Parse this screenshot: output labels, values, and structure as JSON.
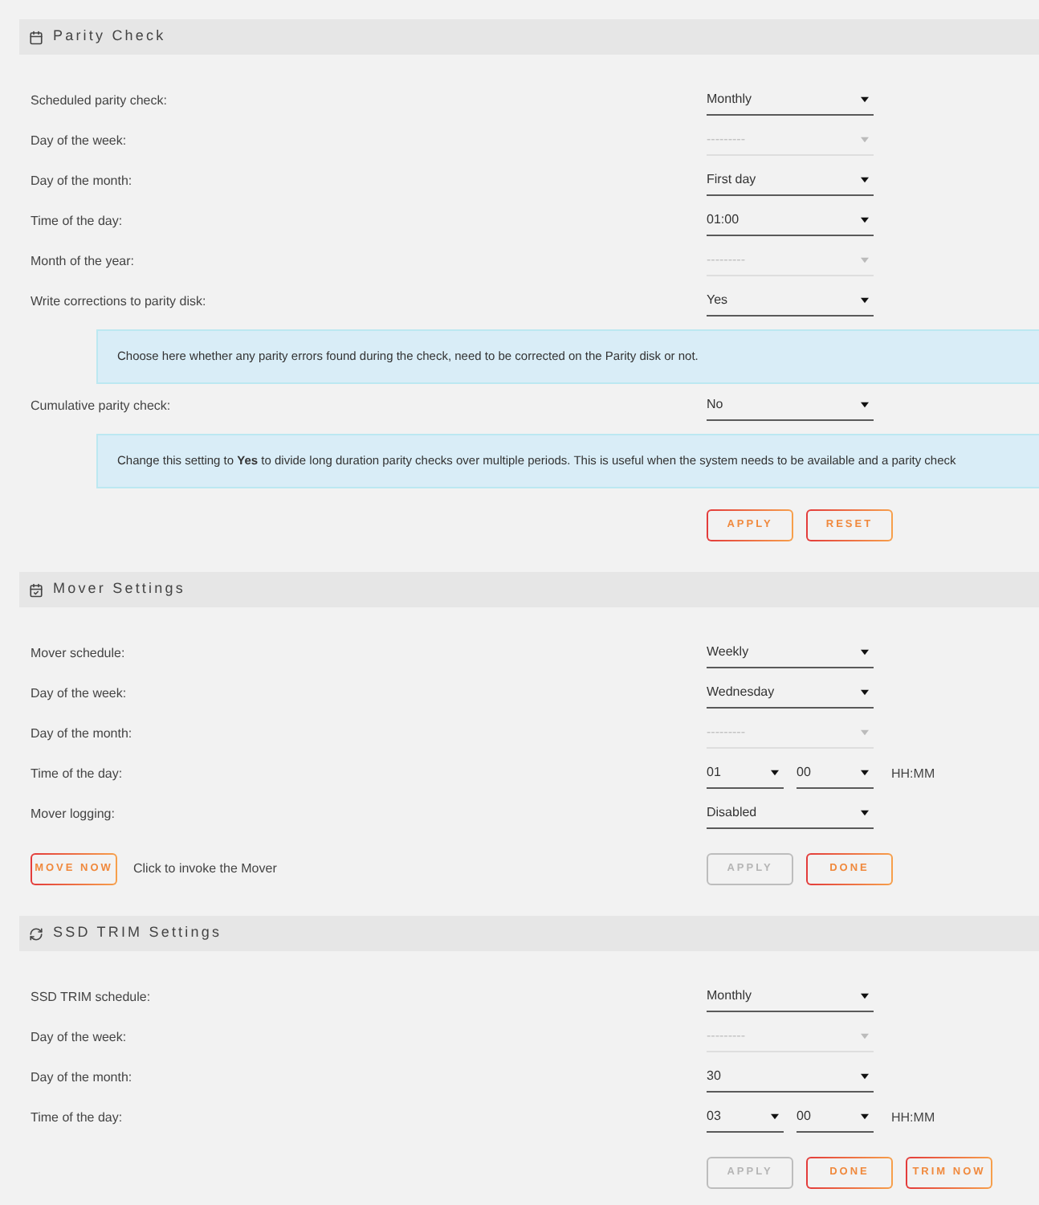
{
  "sections": [
    {
      "title": "Parity Check",
      "rows": [
        {
          "kind": "field",
          "label": "Scheduled parity check:",
          "selects": [
            {
              "value": "Monthly",
              "disabled": false
            }
          ]
        },
        {
          "kind": "field",
          "label": "Day of the week:",
          "selects": [
            {
              "value": "---------",
              "disabled": true
            }
          ]
        },
        {
          "kind": "field",
          "label": "Day of the month:",
          "selects": [
            {
              "value": "First day",
              "disabled": false
            }
          ]
        },
        {
          "kind": "field",
          "label": "Time of the day:",
          "selects": [
            {
              "value": "01:00",
              "disabled": false
            }
          ]
        },
        {
          "kind": "field",
          "label": "Month of the year:",
          "selects": [
            {
              "value": "---------",
              "disabled": true
            }
          ]
        },
        {
          "kind": "field",
          "label": "Write corrections to parity disk:",
          "selects": [
            {
              "value": "Yes",
              "disabled": false
            }
          ]
        },
        {
          "kind": "info",
          "text": "Choose here whether any parity errors found during the check, need to be corrected on the Parity disk or not."
        },
        {
          "kind": "field",
          "label": "Cumulative parity check:",
          "selects": [
            {
              "value": "No",
              "disabled": false
            }
          ]
        },
        {
          "kind": "info",
          "text": "Change this setting to **Yes** to divide long duration parity checks over multiple periods. This is useful when the system needs to be available and a parity check"
        }
      ],
      "actions": {
        "buttons": [
          {
            "label": "APPLY",
            "disabled": false
          },
          {
            "label": "RESET",
            "disabled": false
          }
        ]
      }
    },
    {
      "title": "Mover Settings",
      "rows": [
        {
          "kind": "field",
          "label": "Mover schedule:",
          "selects": [
            {
              "value": "Weekly",
              "disabled": false
            }
          ]
        },
        {
          "kind": "field",
          "label": "Day of the week:",
          "selects": [
            {
              "value": "Wednesday",
              "disabled": false
            }
          ]
        },
        {
          "kind": "field",
          "label": "Day of the month:",
          "selects": [
            {
              "value": "---------",
              "disabled": true
            }
          ]
        },
        {
          "kind": "field",
          "label": "Time of the day:",
          "selects": [
            {
              "value": "01",
              "disabled": false
            },
            {
              "value": "00",
              "disabled": false
            }
          ],
          "suffix": "HH:MM"
        },
        {
          "kind": "field",
          "label": "Mover logging:",
          "selects": [
            {
              "value": "Disabled",
              "disabled": false
            }
          ]
        }
      ],
      "actions": {
        "left_buttons": [
          {
            "label": "MOVE NOW",
            "disabled": false
          }
        ],
        "note": "Click to invoke the Mover",
        "buttons": [
          {
            "label": "APPLY",
            "disabled": true
          },
          {
            "label": "DONE",
            "disabled": false
          }
        ]
      }
    },
    {
      "title": "SSD TRIM Settings",
      "rows": [
        {
          "kind": "field",
          "label": "SSD TRIM schedule:",
          "selects": [
            {
              "value": "Monthly",
              "disabled": false
            }
          ]
        },
        {
          "kind": "field",
          "label": "Day of the week:",
          "selects": [
            {
              "value": "---------",
              "disabled": true
            }
          ]
        },
        {
          "kind": "field",
          "label": "Day of the month:",
          "selects": [
            {
              "value": "30",
              "disabled": false
            }
          ]
        },
        {
          "kind": "field",
          "label": "Time of the day:",
          "selects": [
            {
              "value": "03",
              "disabled": false
            },
            {
              "value": "00",
              "disabled": false
            }
          ],
          "suffix": "HH:MM"
        }
      ],
      "actions": {
        "buttons": [
          {
            "label": "APPLY",
            "disabled": true
          },
          {
            "label": "DONE",
            "disabled": false
          },
          {
            "label": "TRIM NOW",
            "disabled": false
          }
        ]
      }
    }
  ]
}
